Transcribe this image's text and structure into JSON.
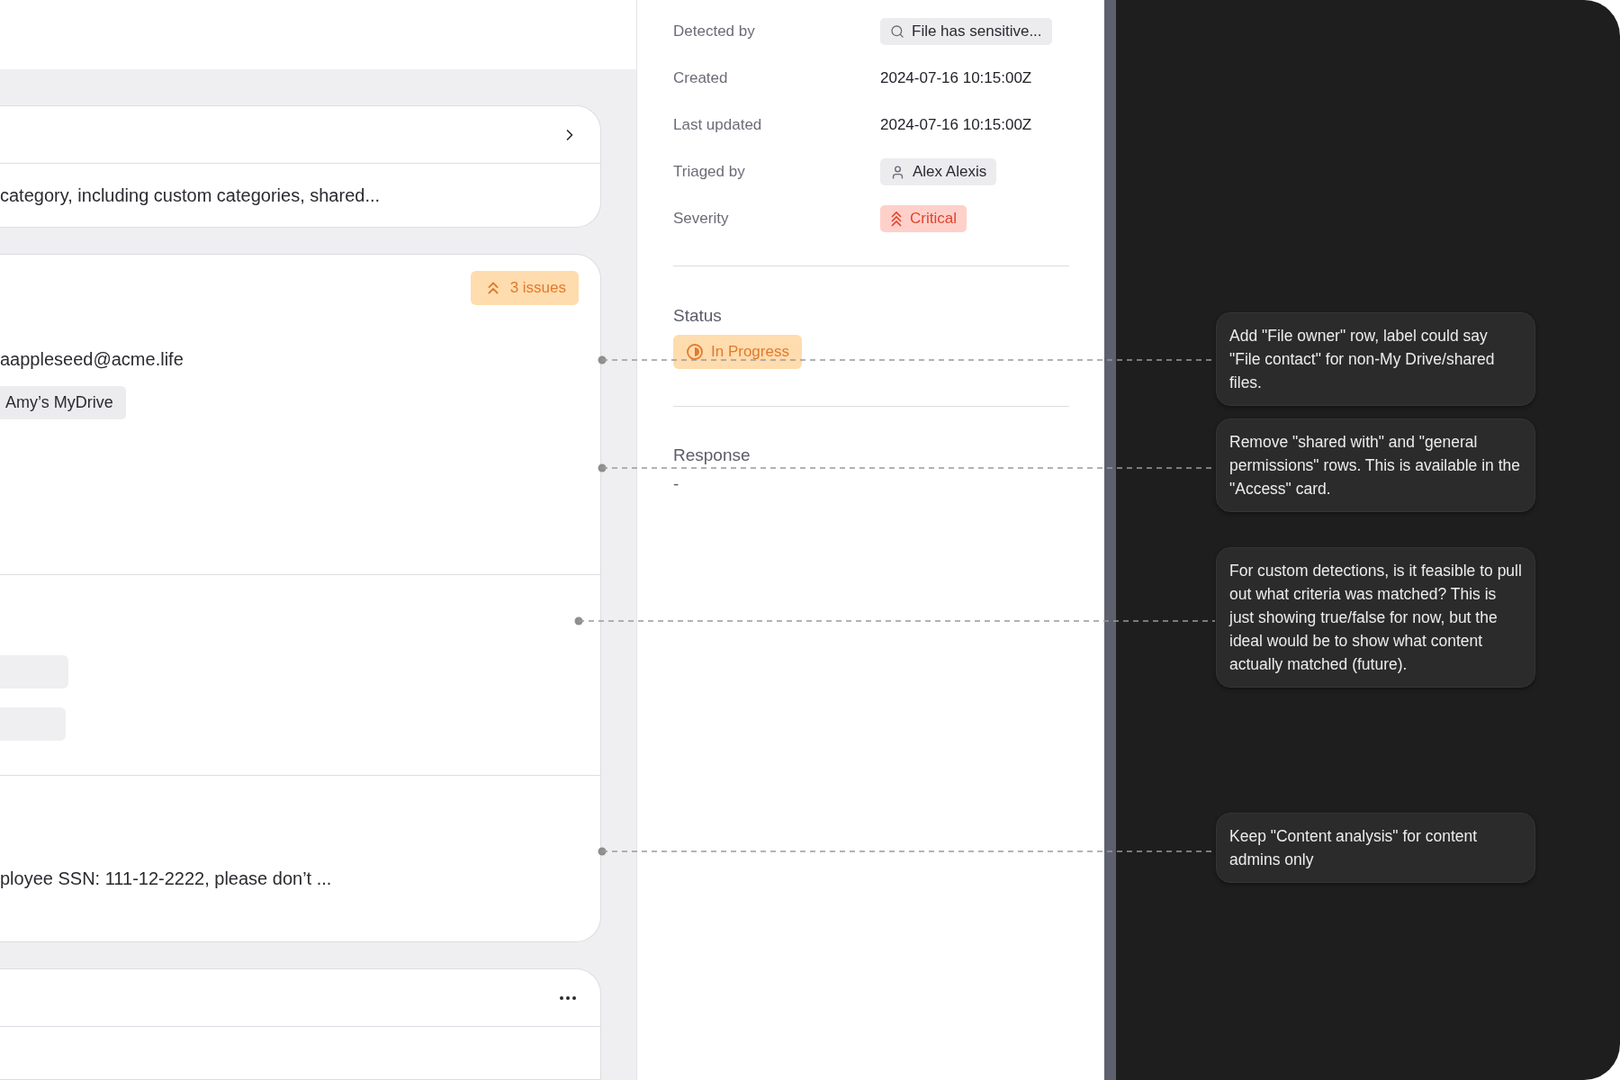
{
  "summary_card": {
    "description": "category, including custom categories, shared..."
  },
  "file_card": {
    "issues_badge": "3 issues",
    "owner_email": "aappleseed@acme.life",
    "location_chip": "Amy’s MyDrive",
    "content_snippet": "ployee SSN: 111-12-2222, please don’t ..."
  },
  "details": {
    "rows": [
      {
        "label": "Detected by",
        "value": "File has sensitive...",
        "kind": "detector"
      },
      {
        "label": "Created",
        "value": "2024-07-16 10:15:00Z",
        "kind": "text"
      },
      {
        "label": "Last updated",
        "value": "2024-07-16 10:15:00Z",
        "kind": "text"
      },
      {
        "label": "Triaged by",
        "value": "Alex Alexis",
        "kind": "person"
      },
      {
        "label": "Severity",
        "value": "Critical",
        "kind": "severity"
      }
    ]
  },
  "status": {
    "label": "Status",
    "value": "In Progress"
  },
  "response": {
    "label": "Response",
    "value": "-"
  },
  "comments": [
    {
      "text": "Add \"File owner\" row, label could say \"File contact\" for non-My Drive/shared files."
    },
    {
      "text": "Remove \"shared with\" and \"general permissions\" rows. This is available in the \"Access\" card."
    },
    {
      "text": "For custom detections, is it feasible to pull out what criteria was matched? This is just showing true/false for now, but the ideal would be to show what content actually matched (future)."
    },
    {
      "text": "Keep \"Content analysis\" for content admins only"
    }
  ]
}
